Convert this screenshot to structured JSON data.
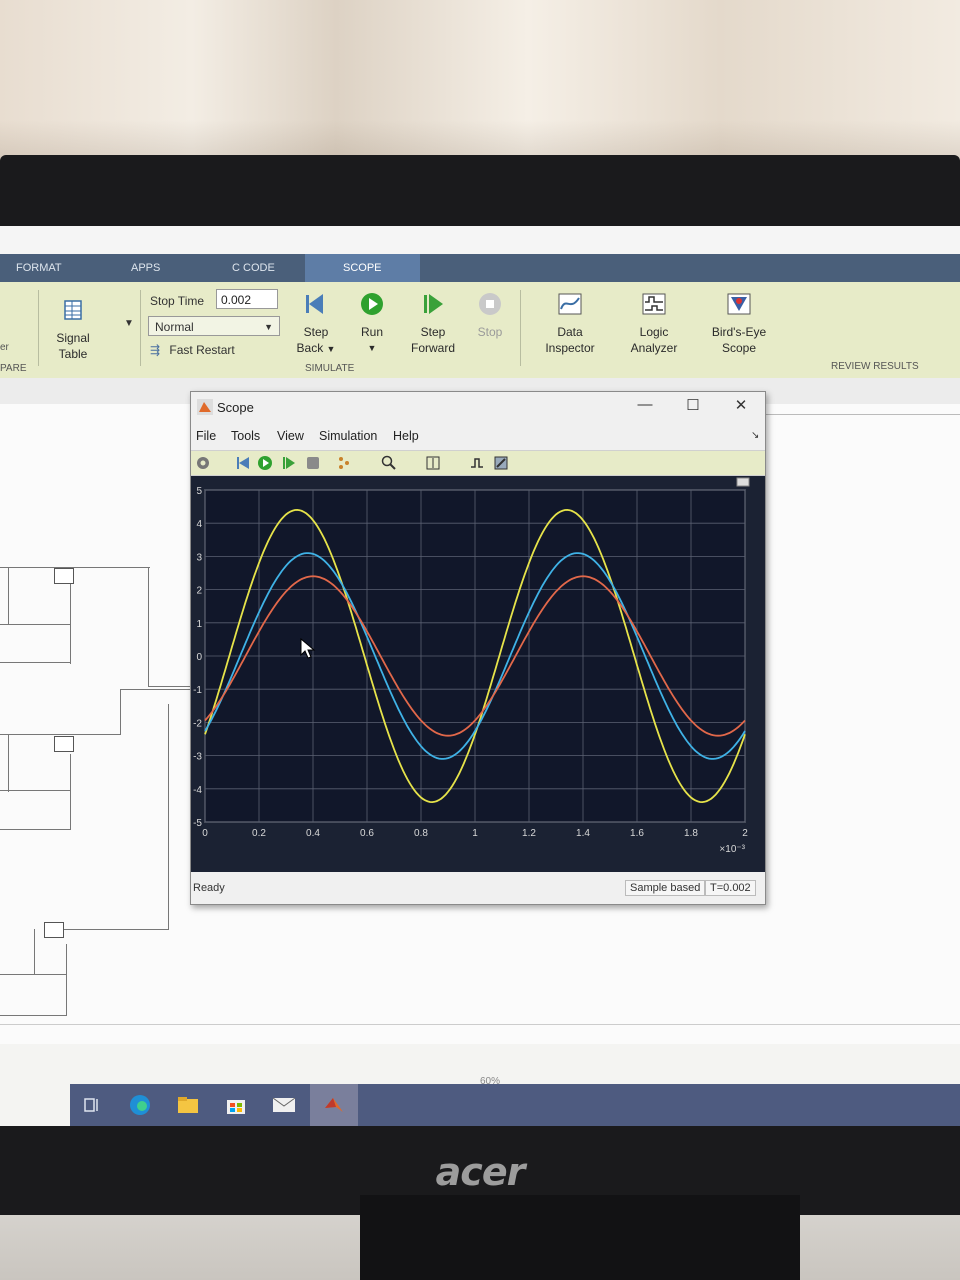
{
  "ribbon": {
    "tabs": [
      {
        "label": "FORMAT"
      },
      {
        "label": "APPS"
      },
      {
        "label": "C CODE"
      },
      {
        "label": "SCOPE"
      }
    ],
    "signal_table": {
      "line1": "Signal",
      "line2": "Table"
    },
    "stop_time_label": "Stop Time",
    "stop_time_value": "0.002",
    "sim_mode": "Normal",
    "fast_restart": "Fast Restart",
    "step_back": {
      "line1": "Step",
      "line2": "Back"
    },
    "run": "Run",
    "step_forward": {
      "line1": "Step",
      "line2": "Forward"
    },
    "stop": "Stop",
    "data_inspector": {
      "line1": "Data",
      "line2": "Inspector"
    },
    "logic_analyzer": {
      "line1": "Logic",
      "line2": "Analyzer"
    },
    "birds_eye": {
      "line1": "Bird's-Eye",
      "line2": "Scope"
    },
    "group_prepare": "PARE",
    "group_simulate": "SIMULATE",
    "group_review": "REVIEW RESULTS",
    "left_cut": "er"
  },
  "scope": {
    "title": "Scope",
    "menu": [
      "File",
      "Tools",
      "View",
      "Simulation",
      "Help"
    ],
    "status": "Ready",
    "sample_mode": "Sample based",
    "time": "T=0.002",
    "exponent": "×10⁻³"
  },
  "taskbar": {
    "zoom": "60%"
  },
  "monitor_brand": "acer",
  "chart_data": {
    "type": "line",
    "xlim": [
      0,
      2
    ],
    "ylim": [
      -5,
      5
    ],
    "x_ticks": [
      "0",
      "0.2",
      "0.4",
      "0.6",
      "0.8",
      "1",
      "1.2",
      "1.4",
      "1.6",
      "1.8",
      "2"
    ],
    "y_ticks": [
      "5",
      "4",
      "3",
      "2",
      "1",
      "0",
      "-1",
      "-2",
      "-3",
      "-4",
      "-5"
    ],
    "grid": true,
    "series": [
      {
        "color": "#e6e34a",
        "amplitude": 4.4,
        "period": 1.0,
        "peak_x": 0.34,
        "offset": 0.0
      },
      {
        "color": "#3fb2e6",
        "amplitude": 3.1,
        "period": 1.0,
        "peak_x": 0.38,
        "offset": 0.0
      },
      {
        "color": "#e2684a",
        "amplitude": 2.4,
        "period": 1.0,
        "peak_x": 0.4,
        "offset": 0.0
      }
    ]
  }
}
